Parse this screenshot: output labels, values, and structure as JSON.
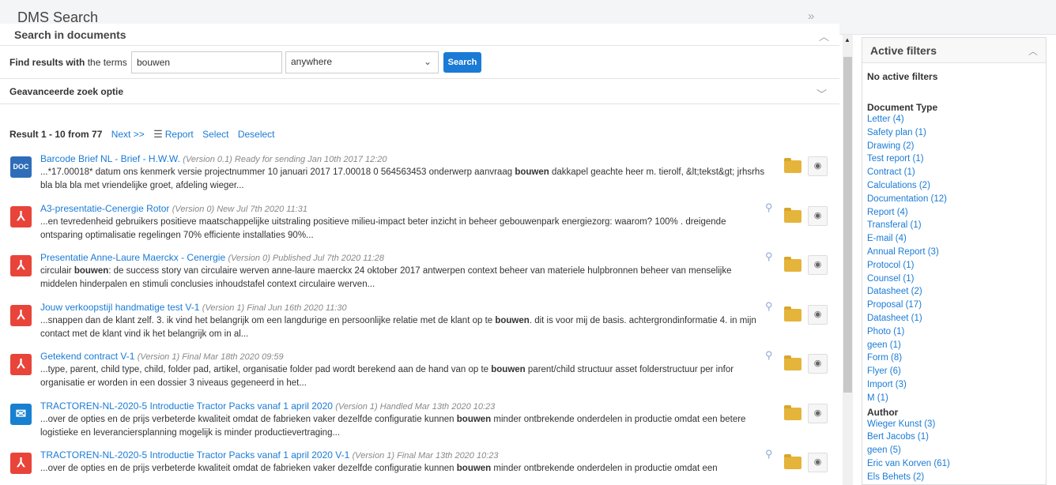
{
  "app_title": "DMS Search",
  "search": {
    "section_title": "Search in documents",
    "find_label_bold": "Find results with",
    "find_label_rest": "the terms",
    "term_value": "bouwen",
    "where_value": "anywhere",
    "button_label": "Search",
    "advanced_label": "Geavanceerde zoek optie"
  },
  "results_bar": {
    "count": "Result 1 - 10 from 77",
    "next": "Next >>",
    "report": "Report",
    "select": "Select",
    "deselect": "Deselect"
  },
  "results": [
    {
      "icon": "doc",
      "title": "Barcode Brief NL - Brief - H.W.W.",
      "meta": "(Version 0.1) Ready for sending Jan 10th 2017 12:20",
      "pre": "...*17.00018* datum ons kenmerk versie projectnummer 10 januari 2017 17.00018 0 564563453 onderwerp aanvraag ",
      "kw": "bouwen",
      "post": " dakkapel geachte heer m. tierolf, &lt;tekst&gt; jrhsrhs bla bla bla met vriendelijke groet, afdeling wieger...",
      "preview": false
    },
    {
      "icon": "pdf",
      "title": "A3-presentatie-Cenergie Rotor",
      "meta": "(Version 0) New Jul 7th 2020 11:31",
      "pre": "...en tevredenheid gebruikers positieve maatschappelijke uitstraling positieve milieu-impact beter inzicht in beheer gebouwenpark energiezorg: waarom? 100% . dreigende ontsparing optimalisatie regelingen 70% efficiente installaties 90%...",
      "kw": "",
      "post": "",
      "preview": true
    },
    {
      "icon": "pdf",
      "title": "Presentatie Anne-Laure Maerckx - Cenergie",
      "meta": "(Version 0) Published Jul 7th 2020 11:28",
      "pre": "circulair ",
      "kw": "bouwen",
      "post": ": de success story van circulaire werven anne-laure maerckx 24 oktober 2017 antwerpen context beheer van materiele hulpbronnen beheer van menselijke middelen hinderpalen en stimuli conclusies inhoudstafel context circulaire werven...",
      "preview": true
    },
    {
      "icon": "pdf",
      "title": "Jouw verkoopstijl handmatige test V-1",
      "meta": "(Version 1) Final Jun 16th 2020 11:30",
      "pre": "...snappen dan de klant zelf. 3. ik vind het belangrijk om een langdurige en persoonlijke relatie met de klant op te ",
      "kw": "bouwen",
      "post": ". dit is voor mij de basis. achtergrondinformatie 4. in mijn contact met de klant vind ik het belangrijk om in al...",
      "preview": true
    },
    {
      "icon": "pdf",
      "title": "Getekend contract V-1",
      "meta": "(Version 1) Final Mar 18th 2020 09:59",
      "pre": "...type, parent, child type, child, folder pad, artikel, organisatie folder pad wordt berekend aan de hand van op te ",
      "kw": "bouwen",
      "post": " parent/child structuur asset folderstructuur per infor organisatie er worden in een dossier 3 niveaus gegeneerd in het...",
      "preview": true
    },
    {
      "icon": "mail",
      "title": "TRACTOREN-NL-2020-5 Introductie Tractor Packs vanaf 1 april 2020",
      "meta": "(Version 1) Handled Mar 13th 2020 10:23",
      "pre": "...over de opties en de prijs verbeterde kwaliteit omdat de fabrieken vaker dezelfde configuratie kunnen ",
      "kw": "bouwen",
      "post": " minder ontbrekende onderdelen in productie omdat een betere logistieke en leveranciersplanning mogelijk is minder productievertraging...",
      "preview": false
    },
    {
      "icon": "pdf",
      "title": "TRACTOREN-NL-2020-5 Introductie Tractor Packs vanaf 1 april 2020 V-1",
      "meta": "(Version 1) Final Mar 13th 2020 10:23",
      "pre": "...over de opties en de prijs verbeterde kwaliteit omdat de fabrieken vaker dezelfde configuratie kunnen ",
      "kw": "bouwen",
      "post": " minder ontbrekende onderdelen in productie omdat een",
      "preview": true
    }
  ],
  "filters": {
    "title": "Active filters",
    "none": "No active filters",
    "doc_type_title": "Document Type",
    "doc_types": [
      "Letter (4)",
      "Safety plan (1)",
      "Drawing (2)",
      "Test report (1)",
      "Contract (1)",
      "Calculations (2)",
      "Documentation (12)",
      "Report (4)",
      "Transferal (1)",
      "E-mail (4)",
      "Annual Report (3)",
      "Protocol (1)",
      "Counsel (1)",
      "Datasheet (2)",
      "Proposal (17)",
      "Datasheet (1)",
      "Photo (1)",
      "geen (1)",
      "Form (8)",
      "Flyer (6)",
      "Import (3)",
      "M (1)"
    ],
    "author_title": "Author",
    "authors": [
      "Wieger Kunst (3)",
      "Bert Jacobs (1)",
      "geen (5)",
      "Eric van Korven (61)",
      "Els Behets (2)"
    ]
  },
  "colors": {
    "accent": "#1a7bd6",
    "pdf": "#e8443a",
    "doc": "#2f6db8",
    "folder": "#e5b43a"
  }
}
